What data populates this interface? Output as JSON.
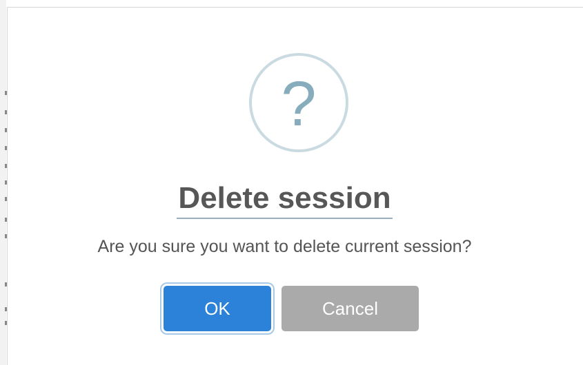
{
  "dialog": {
    "icon": "question-icon",
    "icon_glyph": "?",
    "title": "Delete session",
    "message": "Are you sure you want to delete current session?",
    "buttons": {
      "ok_label": "OK",
      "cancel_label": "Cancel"
    }
  },
  "colors": {
    "ok_button": "#2c82d8",
    "cancel_button": "#aaaaaa",
    "icon_ring": "#c9dae1",
    "icon_glyph": "#87adbd",
    "title_text": "#575757"
  }
}
